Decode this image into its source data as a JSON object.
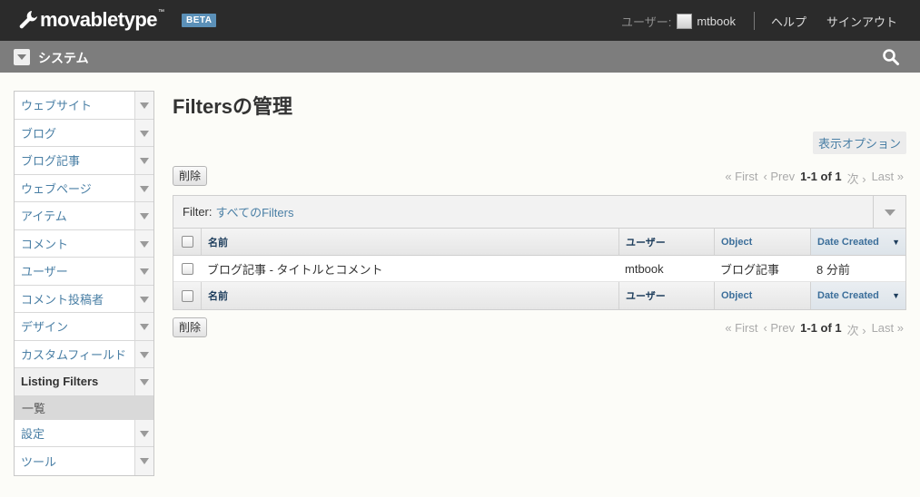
{
  "header": {
    "logo_text": "movabletype",
    "logo_tm": "™",
    "beta": "BETA",
    "user_label": "ユーザー:",
    "username": "mtbook",
    "help": "ヘルプ",
    "signout": "サインアウト"
  },
  "scope": {
    "title": "システム"
  },
  "sidebar": {
    "items": [
      {
        "label": "ウェブサイト"
      },
      {
        "label": "ブログ"
      },
      {
        "label": "ブログ記事"
      },
      {
        "label": "ウェブページ"
      },
      {
        "label": "アイテム"
      },
      {
        "label": "コメント"
      },
      {
        "label": "ユーザー"
      },
      {
        "label": "コメント投稿者"
      },
      {
        "label": "デザイン"
      },
      {
        "label": "カスタムフィールド"
      },
      {
        "label": "Listing Filters"
      },
      {
        "label": "設定"
      },
      {
        "label": "ツール"
      }
    ],
    "sub_item": "一覧"
  },
  "main": {
    "title": "Filtersの管理",
    "display_options": "表示オプション",
    "delete_label": "削除",
    "pager": {
      "first": "« First",
      "prev": "‹ Prev",
      "current": "1-1 of 1",
      "next": "次 ›",
      "last": "Last »"
    },
    "filter": {
      "label": "Filter:",
      "value": "すべてのFilters"
    },
    "columns": {
      "name": "名前",
      "user": "ユーザー",
      "object": "Object",
      "date": "Date Created",
      "sort_indicator": "▼"
    },
    "rows": [
      {
        "name": "ブログ記事 - タイトルとコメント",
        "user": "mtbook",
        "object": "ブログ記事",
        "date": "8 分前"
      }
    ]
  }
}
